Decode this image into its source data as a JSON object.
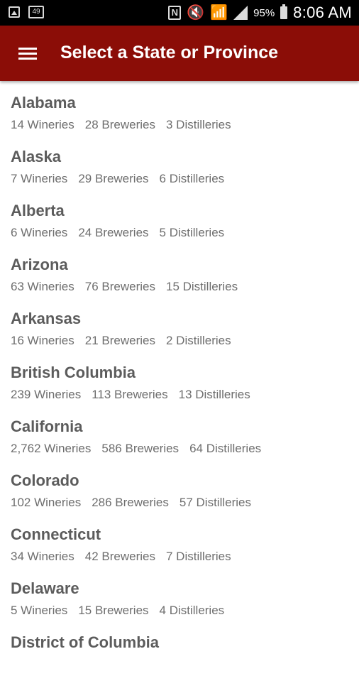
{
  "status_bar": {
    "notification_count": "49",
    "nfc_label": "N",
    "mute_icon": "muted-speaker-icon",
    "wifi_icon": "wifi-icon",
    "battery": "95%",
    "time": "8:06 AM"
  },
  "toolbar": {
    "title": "Select a State or Province",
    "menu_icon": "hamburger-menu-icon",
    "background_color": "#8b0d07"
  },
  "regions": [
    {
      "name": "Alabama",
      "wineries": "14 Wineries",
      "breweries": "28 Breweries",
      "distilleries": "3 Distilleries"
    },
    {
      "name": "Alaska",
      "wineries": "7 Wineries",
      "breweries": "29 Breweries",
      "distilleries": "6 Distilleries"
    },
    {
      "name": "Alberta",
      "wineries": "6 Wineries",
      "breweries": "24 Breweries",
      "distilleries": "5 Distilleries"
    },
    {
      "name": "Arizona",
      "wineries": "63 Wineries",
      "breweries": "76 Breweries",
      "distilleries": "15 Distilleries"
    },
    {
      "name": "Arkansas",
      "wineries": "16 Wineries",
      "breweries": "21 Breweries",
      "distilleries": "2 Distilleries"
    },
    {
      "name": "British Columbia",
      "wineries": "239 Wineries",
      "breweries": "113 Breweries",
      "distilleries": "13 Distilleries"
    },
    {
      "name": "California",
      "wineries": "2,762 Wineries",
      "breweries": "586 Breweries",
      "distilleries": "64 Distilleries"
    },
    {
      "name": "Colorado",
      "wineries": "102 Wineries",
      "breweries": "286 Breweries",
      "distilleries": "57 Distilleries"
    },
    {
      "name": "Connecticut",
      "wineries": "34 Wineries",
      "breweries": "42 Breweries",
      "distilleries": "7 Distilleries"
    },
    {
      "name": "Delaware",
      "wineries": "5 Wineries",
      "breweries": "15 Breweries",
      "distilleries": "4 Distilleries"
    },
    {
      "name": "District of Columbia",
      "wineries": "",
      "breweries": "",
      "distilleries": ""
    }
  ]
}
